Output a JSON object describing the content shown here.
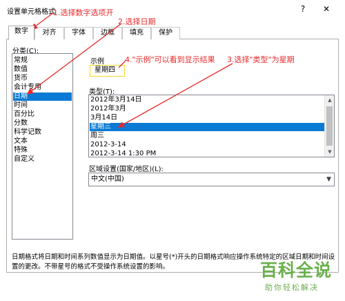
{
  "window": {
    "title": "设置单元格格式"
  },
  "title_buttons": {
    "help": "?",
    "close": "✕"
  },
  "tabs": [
    "数字",
    "对齐",
    "字体",
    "边框",
    "填充",
    "保护"
  ],
  "category": {
    "label": "分类(C):",
    "items": [
      "常规",
      "数值",
      "货币",
      "会计专用",
      "日期",
      "时间",
      "百分比",
      "分数",
      "科学记数",
      "文本",
      "特殊",
      "自定义"
    ],
    "selected": "日期"
  },
  "sample": {
    "label": "示例",
    "value": "星期四"
  },
  "type": {
    "label": "类型(T):",
    "items": [
      "2012年3月14日",
      "2012年3月",
      "3月14日",
      "星期三",
      "周三",
      "2012-3-14",
      "2012-3-14 1:30 PM"
    ],
    "selected": "星期三"
  },
  "locale": {
    "label": "区域设置(国家/地区)(L):",
    "value": "中文(中国)"
  },
  "description": "日期格式将日期和时间系列数值显示为日期值。以星号(*)开头的日期格式响应操作系统特定的区域日期和时间设置的更改。不带星号的格式不受操作系统设置的影响。",
  "annotations": {
    "a1": "1.选择数字选项开",
    "a2": "2.选择日期",
    "a3": "3.选择\"类型\"为星期",
    "a4": "4.\"示例\"可以看到显示结果"
  },
  "watermark": {
    "title": "百科全说",
    "subtitle": "助你轻松解决"
  },
  "colors": {
    "selection": "#0a7ad4",
    "annotation": "#e8282a",
    "sample_border": "#f5d72a",
    "watermark": "#6ab04c"
  }
}
